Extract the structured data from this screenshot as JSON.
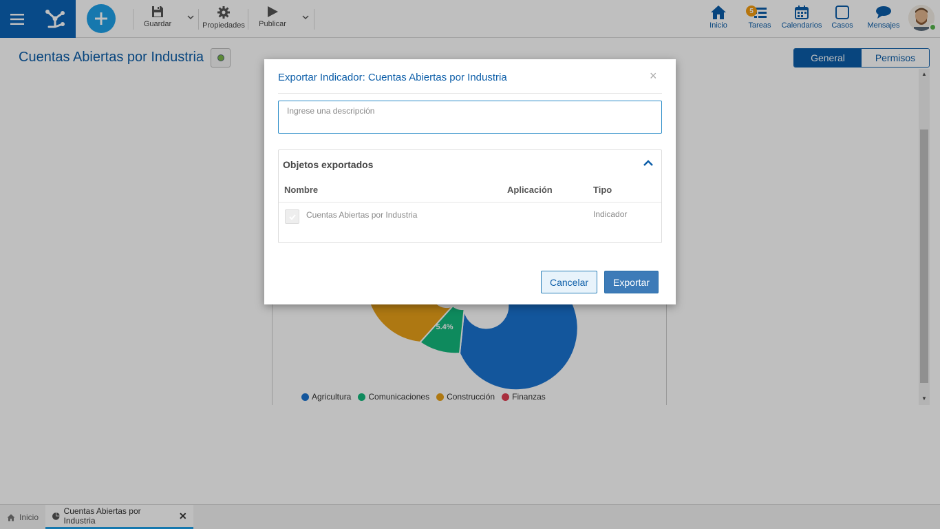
{
  "toolbar": {
    "save_label": "Guardar",
    "properties_label": "Propiedades",
    "publish_label": "Publicar"
  },
  "nav": {
    "home_label": "Inicio",
    "tasks_label": "Tareas",
    "tasks_badge": "5",
    "calendars_label": "Calendarios",
    "cases_label": "Casos",
    "messages_label": "Mensajes"
  },
  "page": {
    "title": "Cuentas Abiertas por Industria",
    "tabs": [
      {
        "label": "General",
        "active": true
      },
      {
        "label": "Permisos",
        "active": false
      }
    ]
  },
  "chart": {
    "visible_slice_label": "5.4%",
    "legend": [
      {
        "name": "Agricultura",
        "color": "#1a73d0"
      },
      {
        "name": "Comunicaciones",
        "color": "#13b87c"
      },
      {
        "name": "Construcción",
        "color": "#e8a019"
      },
      {
        "name": "Finanzas",
        "color": "#e03e52"
      }
    ]
  },
  "modal": {
    "title": "Exportar Indicador: Cuentas Abiertas por Industria",
    "close_symbol": "×",
    "description_placeholder": "Ingrese una descripción",
    "panel_title": "Objetos exportados",
    "columns": {
      "name": "Nombre",
      "application": "Aplicación",
      "type": "Tipo"
    },
    "rows": [
      {
        "name": "Cuentas Abiertas por Industria",
        "application": "",
        "type": "Indicador",
        "checked": true
      }
    ],
    "cancel_label": "Cancelar",
    "export_label": "Exportar"
  },
  "bottom_tabs": [
    {
      "label": "Inicio",
      "icon": "home-icon"
    },
    {
      "label": "Cuentas Abiertas por Industria",
      "icon": "pie-chart-icon",
      "closable": true
    }
  ],
  "colors": {
    "brand": "#0b63b6",
    "accent": "#1ea0e8",
    "badge": "#f39c12",
    "primary_button": "#3d7bb8"
  }
}
